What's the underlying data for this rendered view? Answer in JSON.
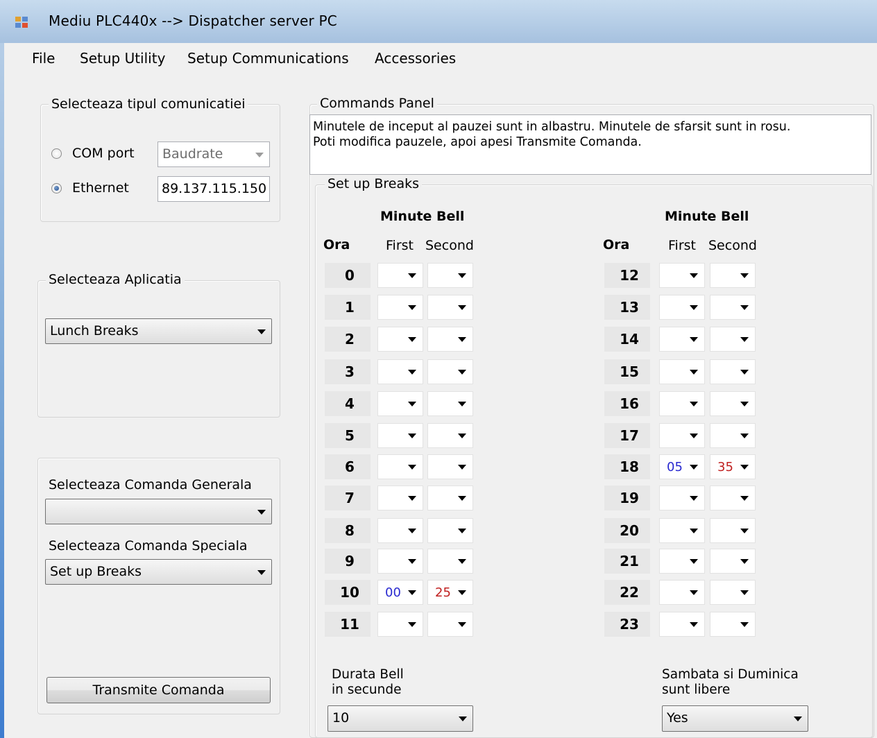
{
  "window": {
    "title": "Mediu PLC440x --> Dispatcher server PC"
  },
  "menu": [
    "File",
    "Setup Utility",
    "Setup Communications",
    "Accessories"
  ],
  "communication": {
    "group_title": "Selecteaza tipul comunicatiei",
    "com_label": "COM port",
    "com_selected": false,
    "baudrate_placeholder": "Baudrate",
    "ethernet_label": "Ethernet",
    "ethernet_selected": true,
    "ip_value": "89.137.115.150"
  },
  "application": {
    "group_title": "Selecteaza Aplicatia",
    "selected": "Lunch Breaks"
  },
  "commands": {
    "general_label": "Selecteaza Comanda Generala",
    "general_selected": "",
    "special_label": "Selecteaza Comanda Speciala",
    "special_selected": "Set up Breaks",
    "transmit_button": "Transmite Comanda"
  },
  "commands_panel": {
    "group_title": "Commands Panel",
    "info_line1": "Minutele de inceput al pauzei sunt in albastru. Minutele de sfarsit sunt in rosu.",
    "info_line2": "Poti modifica pauzele, apoi apesi Transmite Comanda."
  },
  "breaks": {
    "group_title": "Set up Breaks",
    "minute_bell_label": "Minute Bell",
    "ora_label": "Ora",
    "first_label": "First",
    "second_label": "Second",
    "hours": [
      {
        "hour": "0",
        "first": "",
        "second": ""
      },
      {
        "hour": "1",
        "first": "",
        "second": ""
      },
      {
        "hour": "2",
        "first": "",
        "second": ""
      },
      {
        "hour": "3",
        "first": "",
        "second": ""
      },
      {
        "hour": "4",
        "first": "",
        "second": ""
      },
      {
        "hour": "5",
        "first": "",
        "second": ""
      },
      {
        "hour": "6",
        "first": "",
        "second": ""
      },
      {
        "hour": "7",
        "first": "",
        "second": ""
      },
      {
        "hour": "8",
        "first": "",
        "second": ""
      },
      {
        "hour": "9",
        "first": "",
        "second": ""
      },
      {
        "hour": "10",
        "first": "00",
        "second": "25"
      },
      {
        "hour": "11",
        "first": "",
        "second": ""
      },
      {
        "hour": "12",
        "first": "",
        "second": ""
      },
      {
        "hour": "13",
        "first": "",
        "second": ""
      },
      {
        "hour": "14",
        "first": "",
        "second": ""
      },
      {
        "hour": "15",
        "first": "",
        "second": ""
      },
      {
        "hour": "16",
        "first": "",
        "second": ""
      },
      {
        "hour": "17",
        "first": "",
        "second": ""
      },
      {
        "hour": "18",
        "first": "05",
        "second": "35"
      },
      {
        "hour": "19",
        "first": "",
        "second": ""
      },
      {
        "hour": "20",
        "first": "",
        "second": ""
      },
      {
        "hour": "21",
        "first": "",
        "second": ""
      },
      {
        "hour": "22",
        "first": "",
        "second": ""
      },
      {
        "hour": "23",
        "first": "",
        "second": ""
      }
    ],
    "duration_label_line1": "Durata Bell",
    "duration_label_line2": "in secunde",
    "duration_value": "10",
    "weekend_label_line1": "Sambata si Duminica",
    "weekend_label_line2": "sunt libere",
    "weekend_value": "Yes"
  },
  "colors": {
    "first_minute": "#2a2ad0",
    "second_minute": "#c02020"
  }
}
